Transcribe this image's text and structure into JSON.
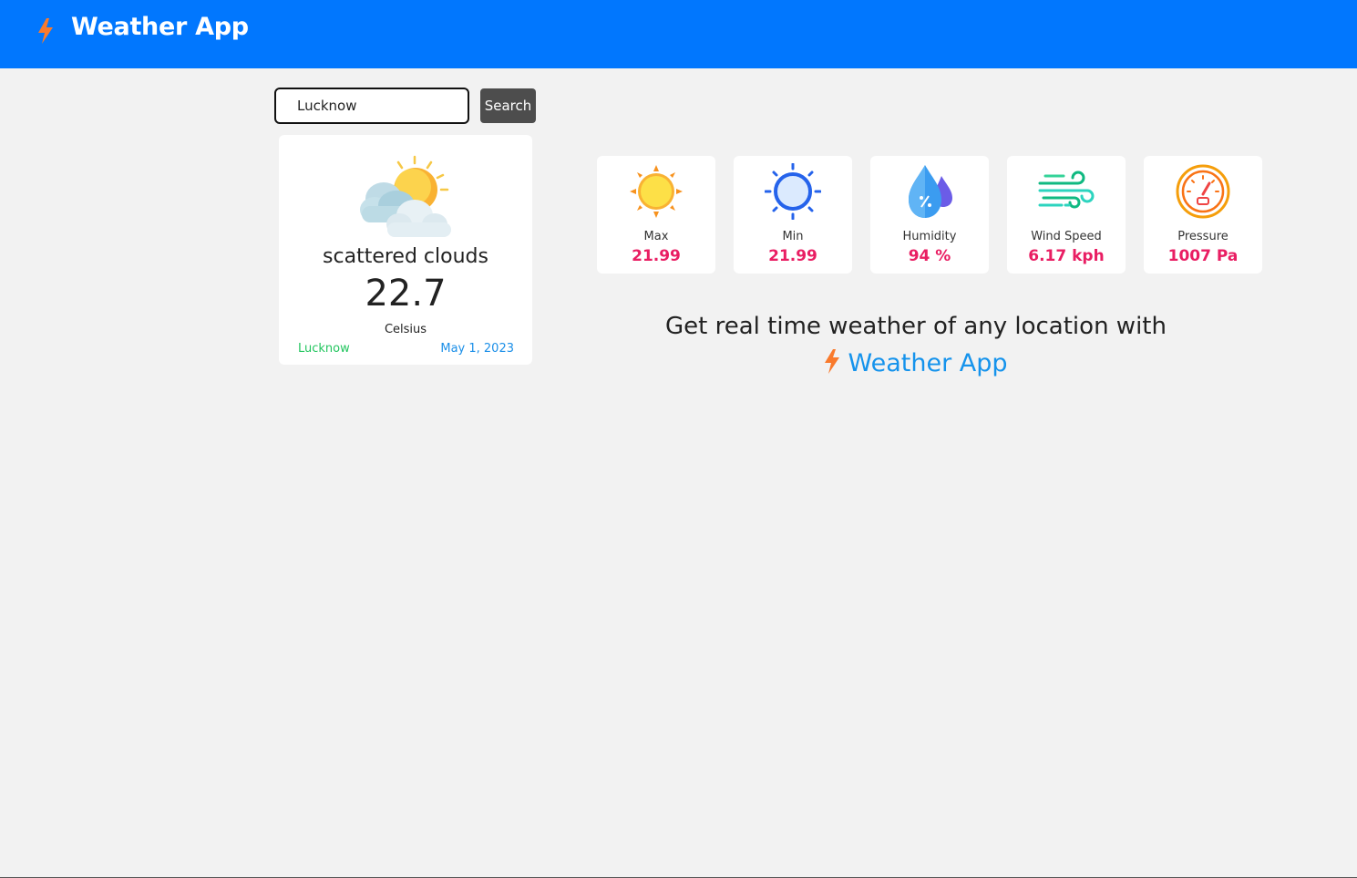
{
  "navbar": {
    "title": "Weather App",
    "logo_icon": "lightning-bolt-icon",
    "bg_color": "#0177fe"
  },
  "search": {
    "value": "Lucknow",
    "button_label": "Search"
  },
  "current": {
    "icon": "sun-behind-clouds-icon",
    "description": "scattered clouds",
    "temperature": "22.7",
    "unit": "Celsius",
    "city": "Lucknow",
    "date": "May 1, 2023"
  },
  "stats": [
    {
      "icon": "sun-icon",
      "label": "Max",
      "value": "21.99"
    },
    {
      "icon": "sun-outline-icon",
      "label": "Min",
      "value": "21.99"
    },
    {
      "icon": "water-drops-icon",
      "label": "Humidity",
      "value": "94 %"
    },
    {
      "icon": "wind-icon",
      "label": "Wind Speed",
      "value": "6.17 kph"
    },
    {
      "icon": "gauge-icon",
      "label": "Pressure",
      "value": "1007 Pa"
    }
  ],
  "promo": {
    "line1": "Get real time weather of any location with",
    "brand": "Weather App"
  },
  "colors": {
    "accent": "#e91e63",
    "city": "#22c55e",
    "date": "#1b8fe8",
    "brand": "#1593ec"
  }
}
